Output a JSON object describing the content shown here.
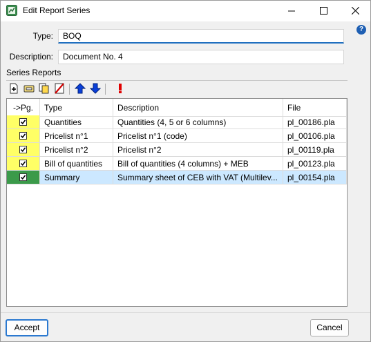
{
  "window": {
    "title": "Edit Report Series"
  },
  "form": {
    "type_label": "Type:",
    "type_value": "BOQ",
    "description_label": "Description:",
    "description_value": "Document No. 4"
  },
  "series_section_label": "Series Reports",
  "toolbar": {
    "icons": [
      "add-icon",
      "edit-icon",
      "copy-icon",
      "delete-icon",
      "move-up-icon",
      "move-down-icon",
      "exclamation-icon"
    ]
  },
  "table": {
    "headers": [
      "->Pg.",
      "Type",
      "Description",
      "File"
    ],
    "rows": [
      {
        "pg": true,
        "type": "Quantities",
        "description": "Quantities (4, 5 or 6 columns)",
        "file": "pl_00186.pla"
      },
      {
        "pg": true,
        "type": "Pricelist n°1",
        "description": "Pricelist n°1 (code)",
        "file": "pl_00106.pla"
      },
      {
        "pg": true,
        "type": "Pricelist n°2",
        "description": "Pricelist n°2",
        "file": "pl_00119.pla"
      },
      {
        "pg": true,
        "type": "Bill of quantities",
        "description": "Bill of quantities (4 columns) + MEB",
        "file": "pl_00123.pla"
      },
      {
        "pg": true,
        "type": "Summary",
        "description": "Summary sheet of CEB with VAT (Multilev...",
        "file": "pl_00154.pla",
        "selected": true
      }
    ]
  },
  "buttons": {
    "accept": "Accept",
    "cancel": "Cancel"
  },
  "colors": {
    "pg_column": "#ffff66",
    "selected_pg": "#3b9a4a",
    "selected_row": "#cce8ff",
    "accent": "#2b79d0"
  }
}
